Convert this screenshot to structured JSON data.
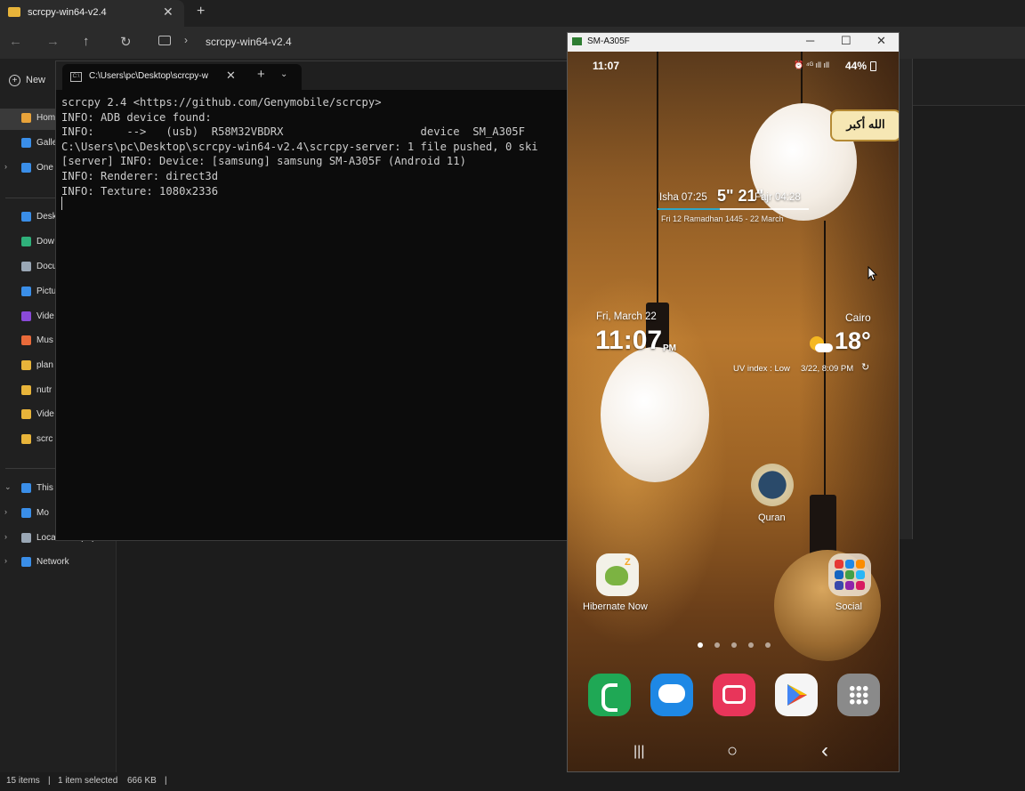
{
  "explorer": {
    "tab_title": "scrcpy-win64-v2.4",
    "tab_close": "✕",
    "new_tab": "+",
    "nav": {
      "back": "←",
      "forward": "→",
      "up": "↑",
      "refresh": "↻"
    },
    "breadcrumb_sep": "›",
    "breadcrumb": "scrcpy-win64-v2.4",
    "new_button": "New",
    "sidebar": [
      {
        "label": "Hom",
        "icon": "home-icon",
        "color": "#e8a33a"
      },
      {
        "label": "Galle",
        "icon": "gallery-icon",
        "color": "#3a8ee8"
      },
      {
        "label": "One",
        "icon": "onedrive-icon",
        "color": "#3a8ee8",
        "chevron": "›"
      },
      {
        "label": "Desk",
        "icon": "desktop-icon",
        "color": "#3a8ee8"
      },
      {
        "label": "Dow",
        "icon": "download-icon",
        "color": "#2fb07a"
      },
      {
        "label": "Docu",
        "icon": "documents-icon",
        "color": "#9aa7b5"
      },
      {
        "label": "Pictu",
        "icon": "pictures-icon",
        "color": "#3a8ee8"
      },
      {
        "label": "Vide",
        "icon": "videos-icon",
        "color": "#8a4ad8"
      },
      {
        "label": "Mus",
        "icon": "music-icon",
        "color": "#e86a3a"
      },
      {
        "label": "plan",
        "icon": "folder-icon",
        "color": "#e8b43a"
      },
      {
        "label": "nutr",
        "icon": "folder-icon",
        "color": "#e8b43a"
      },
      {
        "label": "Vide",
        "icon": "folder-icon",
        "color": "#e8b43a"
      },
      {
        "label": "scrc",
        "icon": "folder-icon",
        "color": "#e8b43a"
      },
      {
        "label": "This",
        "icon": "this-pc-icon",
        "color": "#3a8ee8",
        "chevron": "⌄"
      },
      {
        "label": "Mo",
        "icon": "phone-device-icon",
        "color": "#3a8ee8",
        "chevron": "›"
      },
      {
        "label": "Local Disk (C:)",
        "icon": "disk-icon",
        "color": "#9aa7b5",
        "chevron": "›"
      },
      {
        "label": "Network",
        "icon": "network-icon",
        "color": "#3a8ee8",
        "chevron": "›"
      }
    ],
    "status": {
      "items": "15 items",
      "sep1": "|",
      "selected": "1 item selected",
      "size": "666 KB",
      "sep2": "|"
    }
  },
  "terminal": {
    "tab_title": "C:\\Users\\pc\\Desktop\\scrcpy-w",
    "tab_icon": "C:\\",
    "tab_close": "✕",
    "new_tab": "+",
    "dropdown": "⌄",
    "lines": [
      "scrcpy 2.4 <https://github.com/Genymobile/scrcpy>",
      "INFO: ADB device found:",
      "INFO:     -->   (usb)  R58M32VBDRX                     device  SM_A305F",
      "C:\\Users\\pc\\Desktop\\scrcpy-win64-v2.4\\scrcpy-server: 1 file pushed, 0 ski",
      "[server] INFO: Device: [samsung] samsung SM-A305F (Android 11)",
      "INFO: Renderer: direct3d",
      "INFO: Texture: 1080x2336"
    ]
  },
  "phone": {
    "window_title": "SM-A305F",
    "controls": {
      "minimize": "─",
      "maximize": "☐",
      "close": "✕"
    },
    "status_time": "11:07",
    "status_icons": "⏰ ⁴ᴳ ıll ıll",
    "battery": "44%",
    "prayer": {
      "badge": "الله أكبر",
      "left": "Isha 07:25",
      "countdown": "5\" 21\"",
      "right": "Fajr 04:28",
      "date": "Fri 12 Ramadhan 1445 - 22 March"
    },
    "clock": {
      "date": "Fri, March 22",
      "time": "11:07",
      "ampm": "PM",
      "city": "Cairo",
      "temp": "18°",
      "uv": "UV index : Low",
      "updated": "3/22, 8:09 PM",
      "refresh": "↻"
    },
    "apps": [
      {
        "label": "Quran",
        "icon": "quran-icon"
      },
      {
        "label": "Hibernate Now",
        "icon": "hibernate-icon"
      },
      {
        "label": "Social",
        "icon": "social-folder-icon"
      }
    ],
    "page_dots": 5,
    "dock": [
      {
        "icon": "phone-app-icon",
        "color": "#1fa855"
      },
      {
        "icon": "messages-app-icon",
        "color": "#1e88e5"
      },
      {
        "icon": "camera-app-icon",
        "color": "#e8355a"
      },
      {
        "icon": "play-store-icon",
        "color": "#f5f5f5"
      },
      {
        "icon": "app-drawer-icon",
        "color": "#8a8a8a"
      }
    ],
    "navbar": {
      "recents": "|||",
      "home": "○",
      "back": "‹"
    }
  }
}
